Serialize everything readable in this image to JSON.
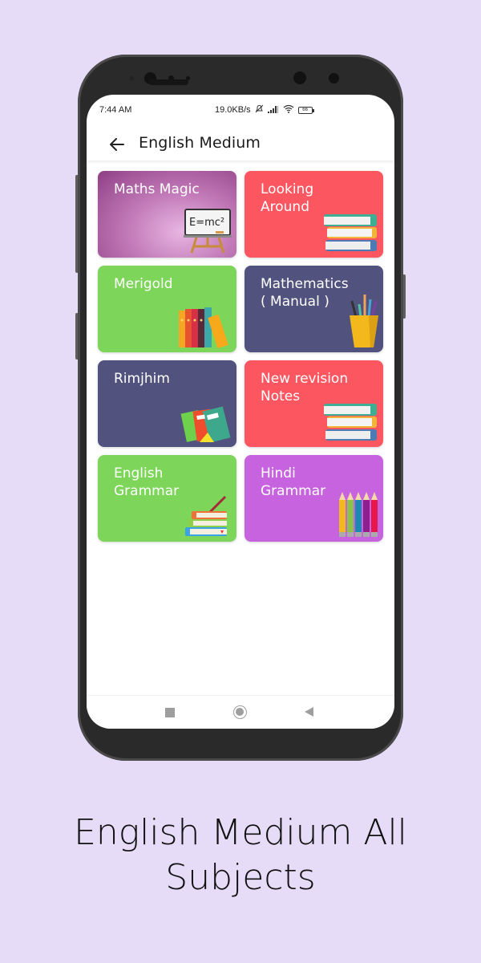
{
  "statusbar": {
    "time": "7:44 AM",
    "network_speed": "19.0KB/s",
    "battery": "66"
  },
  "appbar": {
    "back_icon": "arrow-left-icon",
    "title": "English Medium"
  },
  "subjects": [
    {
      "label": "Maths Magic",
      "color": "#a8579e",
      "icon": "blackboard-icon"
    },
    {
      "label": "Looking\nAround",
      "color": "#fc5660",
      "icon": "books-stack-icon"
    },
    {
      "label": "Merigold",
      "color": "#7dd65a",
      "icon": "bookshelf-icon"
    },
    {
      "label": "Mathematics\n( Manual )",
      "color": "#51537e",
      "icon": "pencil-cup-icon"
    },
    {
      "label": "Rimjhim",
      "color": "#51537e",
      "icon": "notebooks-icon"
    },
    {
      "label": "New revision\nNotes",
      "color": "#fc5660",
      "icon": "books-stack-icon"
    },
    {
      "label": "English\nGrammar",
      "color": "#7dd65a",
      "icon": "books-pen-icon"
    },
    {
      "label": "Hindi\nGrammar",
      "color": "#c863e0",
      "icon": "colored-pencils-icon"
    }
  ],
  "navbar": {
    "recents": "square-icon",
    "home": "circle-icon",
    "back": "triangle-back-icon"
  },
  "caption": "English Medium All\nSubjects"
}
